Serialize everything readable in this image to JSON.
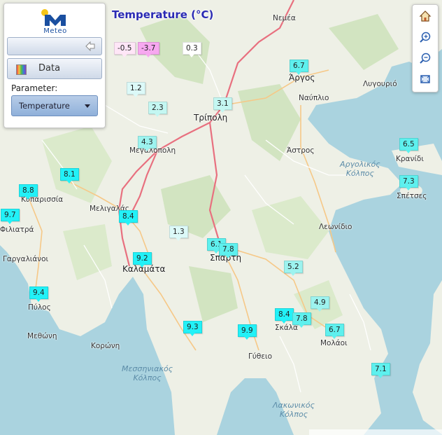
{
  "title": "Temperature (°C)",
  "panel": {
    "logo_text": "Meteo",
    "data_label": "Data",
    "parameter_label": "Parameter:",
    "parameter_value": "Temperature"
  },
  "colors": {
    "cold": "#f7a8f0",
    "cool": "#ffe6f7",
    "neutral": "#ffffff",
    "mild": "#dcf9f8",
    "mild2": "#c4f7f2",
    "warm": "#9df3ef",
    "warmer": "#5ef0ee",
    "hot": "#22f1f7"
  },
  "markers": [
    {
      "value": "-0.5",
      "color": "#ffe6f7"
    },
    {
      "value": "-3.7",
      "color": "#f7a8f0"
    },
    {
      "value": "0.3",
      "color": "#ffffff"
    },
    {
      "value": "1.2",
      "color": "#dcf9f8"
    },
    {
      "value": "2.3",
      "color": "#c4f7f2"
    },
    {
      "value": "3.1",
      "color": "#c4f7f2"
    },
    {
      "value": "4.3",
      "color": "#9df3ef"
    },
    {
      "value": "6.7",
      "color": "#5ef0ee"
    },
    {
      "value": "6.5",
      "color": "#5ef0ee"
    },
    {
      "value": "7.3",
      "color": "#5ef0ee"
    },
    {
      "value": "8.1",
      "color": "#22f1f7"
    },
    {
      "value": "8.8",
      "color": "#22f1f7"
    },
    {
      "value": "9.7",
      "color": "#22f1f7"
    },
    {
      "value": "8.4",
      "color": "#22f1f7"
    },
    {
      "value": "1.3",
      "color": "#dcf9f8"
    },
    {
      "value": "6.1",
      "color": "#5ef0ee"
    },
    {
      "value": "7.8",
      "color": "#5ef0ee"
    },
    {
      "value": "9.2",
      "color": "#22f1f7"
    },
    {
      "value": "5.2",
      "color": "#9df3ef"
    },
    {
      "value": "4.9",
      "color": "#9df3ef"
    },
    {
      "value": "8.4",
      "color": "#22f1f7"
    },
    {
      "value": "7.8",
      "color": "#5ef0ee"
    },
    {
      "value": "6.7",
      "color": "#5ef0ee"
    },
    {
      "value": "9.4",
      "color": "#22f1f7"
    },
    {
      "value": "9.3",
      "color": "#22f1f7"
    },
    {
      "value": "9.9",
      "color": "#22f1f7"
    },
    {
      "value": "7.1",
      "color": "#5ef0ee"
    }
  ],
  "places": [
    "Νεμέα",
    "Άργος",
    "Ναύπλιο",
    "Λυγουριό",
    "Τρίπολη",
    "Άστρος",
    "Μεγαλόπολη",
    "Κυπαρισσία",
    "Μελιγαλάς",
    "Φιλιατρά",
    "Γαργαλιάνοι",
    "Καλαμάτα",
    "Σπάρτη",
    "Λεωνίδιο",
    "Κρανίδι",
    "Σπέτσες",
    "Πύλος",
    "Μεθώνη",
    "Κορώνη",
    "Γύθειο",
    "Σκάλα",
    "Μολάοι"
  ],
  "seas": [
    "Αργολικός\nΚόλπος",
    "Μεσσηνιακός\nΚόλπος",
    "Λακωνικός\nΚόλπος"
  ]
}
